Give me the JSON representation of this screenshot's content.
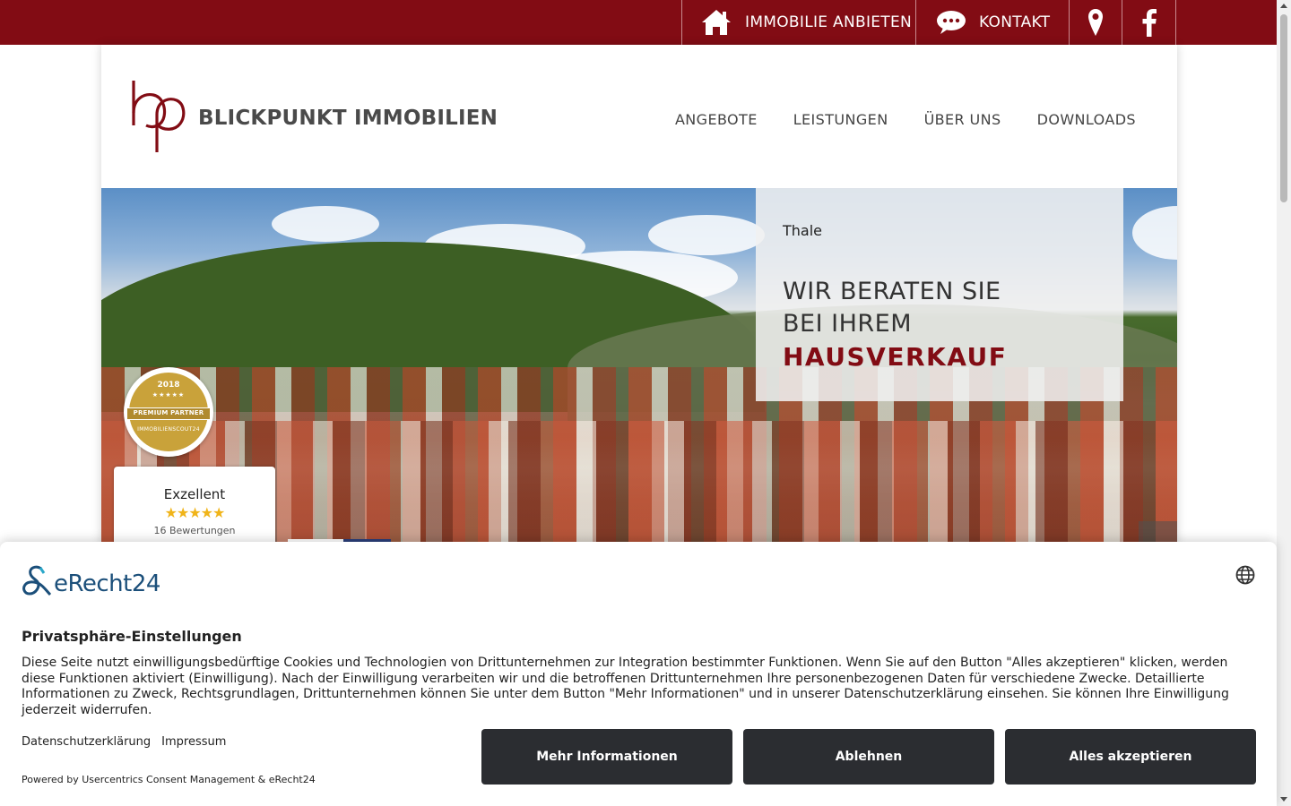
{
  "topbar": {
    "offer_label": "IMMOBILIE ANBIETEN",
    "contact_label": "KONTAKT",
    "icons": [
      "house-icon",
      "speech-bubble-icon",
      "map-pin-icon",
      "facebook-icon"
    ]
  },
  "header": {
    "logo_text": "BLICKPUNKT IMMOBILIEN",
    "nav": [
      "ANGEBOTE",
      "LEISTUNGEN",
      "ÜBER UNS",
      "DOWNLOADS"
    ]
  },
  "hero": {
    "city": "Thale",
    "line1": "WIR BERATEN SIE",
    "line2": "BEI IHREM",
    "line3": "HAUSVERKAUF"
  },
  "badge": {
    "year": "2018",
    "title": "PREMIUM PARTNER",
    "subtitle": "IMMOBILIENSCOUT24",
    "stars": "★★★★★"
  },
  "review": {
    "rating_label": "Exzellent",
    "stars": "★★★★★",
    "rating": 5,
    "count": "16 Bewertungen"
  },
  "consent": {
    "logo_text": "eRecht24",
    "title": "Privatsphäre-Einstellungen",
    "text": "Diese Seite nutzt einwilligungsbedürftige Cookies und Technologien von Drittunternehmen zur Integration bestimmter Funktionen. Wenn Sie auf den Button \"Alles akzeptieren\" klicken, werden diese Funktionen aktiviert (Einwilligung). Nach der Einwilligung verarbeiten wir und die betroffenen Drittunternehmen Ihre personenbezogenen Daten für verschiedene Zwecke. Detaillierte Informationen zu Zweck, Rechtsgrundlagen, Drittunternehmen können Sie unter dem Button \"Mehr Informationen\" und in unserer Datenschutzerklärung einsehen. Sie können Ihre Einwilligung jederzeit widerrufen.",
    "link_privacy": "Datenschutzerklärung",
    "link_imprint": "Impressum",
    "powered": "Powered by Usercentrics Consent Management & eRecht24",
    "btn_more": "Mehr Informationen",
    "btn_deny": "Ablehnen",
    "btn_accept": "Alles akzeptieren"
  },
  "colors": {
    "brand": "#820c14",
    "button": "#2b2d31",
    "badge_gold": "#c9a23a"
  }
}
